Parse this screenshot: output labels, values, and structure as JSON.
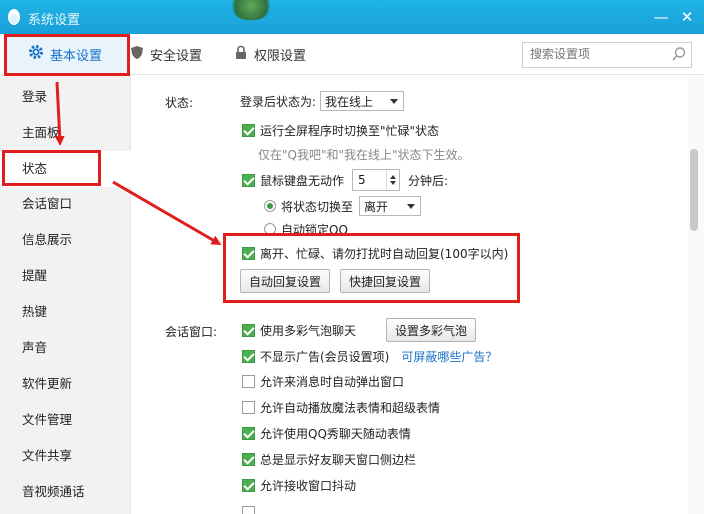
{
  "window": {
    "title": "系统设置",
    "minimize": "—",
    "close": "✕"
  },
  "toolbar": {
    "tabs": [
      {
        "label": "基本设置",
        "icon": "gear-icon"
      },
      {
        "label": "安全设置",
        "icon": "shield-icon"
      },
      {
        "label": "权限设置",
        "icon": "lock-icon"
      }
    ],
    "search_placeholder": "搜索设置项"
  },
  "sidebar": {
    "items": [
      {
        "label": "登录"
      },
      {
        "label": "主面板"
      },
      {
        "label": "状态"
      },
      {
        "label": "会话窗口"
      },
      {
        "label": "信息展示"
      },
      {
        "label": "提醒"
      },
      {
        "label": "热键"
      },
      {
        "label": "声音"
      },
      {
        "label": "软件更新"
      },
      {
        "label": "文件管理"
      },
      {
        "label": "文件共享"
      },
      {
        "label": "音视频通话"
      }
    ]
  },
  "status_section": {
    "label": "状态:",
    "login_status_label": "登录后状态为:",
    "login_status_value": "我在线上",
    "fullscreen_busy": "运行全屏程序时切换至\"忙碌\"状态",
    "fullscreen_hint": "仅在\"Q我吧\"和\"我在线上\"状态下生效。",
    "idle_prefix": "鼠标键盘无动作",
    "idle_minutes": "5",
    "idle_suffix": "分钟后:",
    "switch_status_label": "将状态切换至",
    "switch_status_value": "离开",
    "auto_lock": "自动锁定QQ",
    "auto_reply": "离开、忙碌、请勿打扰时自动回复(100字以内)",
    "auto_reply_button": "自动回复设置",
    "quick_reply_button": "快捷回复设置"
  },
  "session_section": {
    "label": "会话窗口:",
    "colorful_bubble": "使用多彩气泡聊天",
    "colorful_bubble_button": "设置多彩气泡",
    "no_ads": "不显示广告(会员设置项)",
    "no_ads_link": "可屏蔽哪些广告？",
    "auto_popup": "允许来消息时自动弹出窗口",
    "magic_emoji": "允许自动播放魔法表情和超级表情",
    "qq_show": "允许使用QQ秀聊天随动表情",
    "friend_sidebar": "总是显示好友聊天窗口侧边栏",
    "shake": "允许接收窗口抖动"
  },
  "colors": {
    "titlebar": "#1aa0d8",
    "accent": "#1a73c8",
    "check": "#4caf50",
    "annotation": "#e01e1e"
  }
}
